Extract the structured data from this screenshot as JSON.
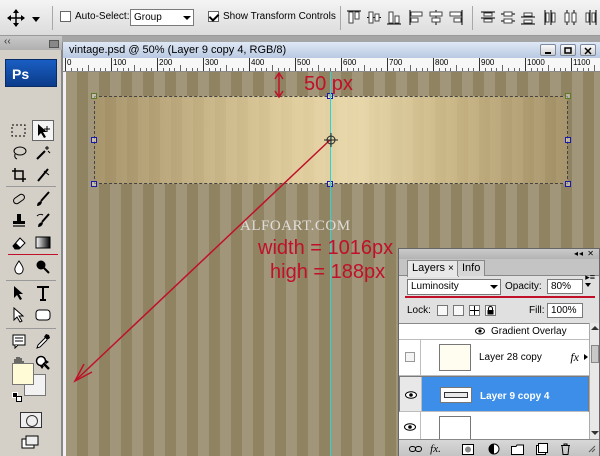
{
  "options_bar": {
    "auto_select_label": "Auto-Select:",
    "auto_select_checked": false,
    "auto_select_mode": "Group",
    "show_transform_label": "Show Transform Controls",
    "show_transform_checked": true
  },
  "tools": {
    "logo": "Ps"
  },
  "document": {
    "title": "vintage.psd @ 50% (Layer 9 copy 4, RGB/8)",
    "ruler_labels": [
      "0",
      "100",
      "200",
      "300",
      "400",
      "500",
      "600",
      "700",
      "800",
      "900",
      "1000",
      "1100"
    ],
    "vruler_label": "8"
  },
  "canvas": {
    "watermark": "ALFOART.COM",
    "annotation_offset": "50 px",
    "annotation_width": "width = 1016px",
    "annotation_height": "high = 188px",
    "annotation_color": "#c0102a",
    "guide_color": "#2ad4d4"
  },
  "layers_panel": {
    "tabs": [
      {
        "label": "Layers",
        "active": true,
        "close": "×"
      },
      {
        "label": "Info",
        "active": false
      }
    ],
    "blend_mode": "Luminosity",
    "opacity_label": "Opacity:",
    "opacity_value": "80%",
    "lock_label": "Lock:",
    "fill_label": "Fill:",
    "fill_value": "100%",
    "layers": [
      {
        "name": "Gradient Overlay",
        "type": "effect"
      },
      {
        "name": "Layer 28 copy",
        "fx": "fx",
        "visible": false
      },
      {
        "name": "Layer 9 copy 4",
        "visible": true,
        "selected": true
      },
      {
        "name": "",
        "visible": true
      }
    ],
    "selected_color": "#3c8ee8"
  }
}
